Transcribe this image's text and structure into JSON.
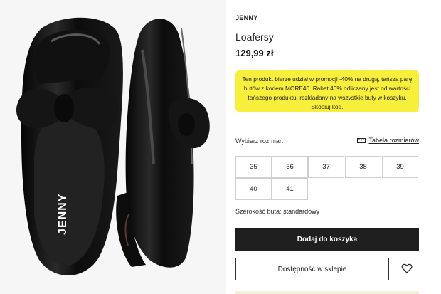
{
  "product": {
    "brand": "JENNY",
    "name": "Loafersy",
    "price": "129,99 zł",
    "image_logo_text": "JENNY"
  },
  "promo": {
    "text": "Ten produkt bierze udział w promocji -40% na drugą, tańszą parę butów z kodem MORE40. Rabat 40% odliczany jest od wartości tańszego produktu, rozkładany na wszystkie buty w koszyku. Skopiuj kod.",
    "background": "#f7ef3c"
  },
  "sizing": {
    "label": "Wybierz rozmiar:",
    "guide_label": "Tabela rozmiarów",
    "guide_icon": "ruler-icon",
    "options": [
      "35",
      "36",
      "37",
      "38",
      "39",
      "40",
      "41"
    ]
  },
  "width": {
    "label": "Szerokość buta:",
    "value": "standardowy"
  },
  "actions": {
    "add_to_cart": "Dodaj do koszyka",
    "store_availability": "Dostępność w sklepie",
    "wishlist_icon": "heart-icon"
  },
  "colors": {
    "primary_button": "#1f1f1f",
    "promo": "#f7ef3c"
  }
}
